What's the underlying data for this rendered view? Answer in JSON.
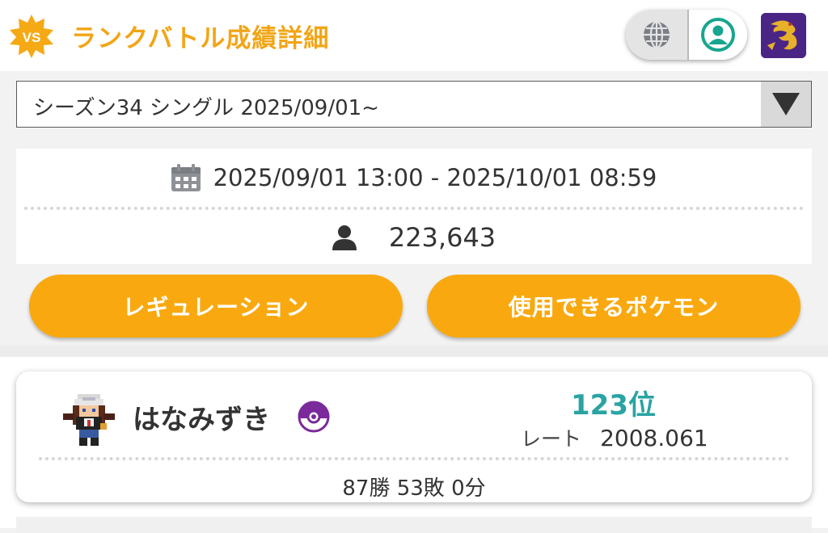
{
  "header": {
    "badge_text": "VS",
    "title": "ランクバトル成績詳細",
    "toggle": {
      "left_icon": "globe-icon",
      "right_icon": "person-circle-icon"
    },
    "avatar_icon": "dragon-avatar-icon",
    "accent_color": "#f2a516"
  },
  "season_select": {
    "selected": "シーズン34 シングル 2025/09/01~",
    "arrow_icon": "triangle-down-icon"
  },
  "season_info": {
    "calendar_icon": "calendar-icon",
    "period": "2025/09/01 13:00 - 2025/10/01 08:59",
    "players_icon": "person-icon",
    "player_count": "223,643"
  },
  "buttons": {
    "regulation": "レギュレーション",
    "usable_pokemon": "使用できるポケモン",
    "color": "#f9a90f"
  },
  "player": {
    "sprite_icon": "trainer-sprite-icon",
    "name": "はなみずき",
    "ball_icon": "master-ball-icon",
    "rank": "123位",
    "rate_label": "レート",
    "rate_value": "2008.061",
    "record": "87勝 53敗 0分",
    "rank_color": "#2aa3a3"
  }
}
